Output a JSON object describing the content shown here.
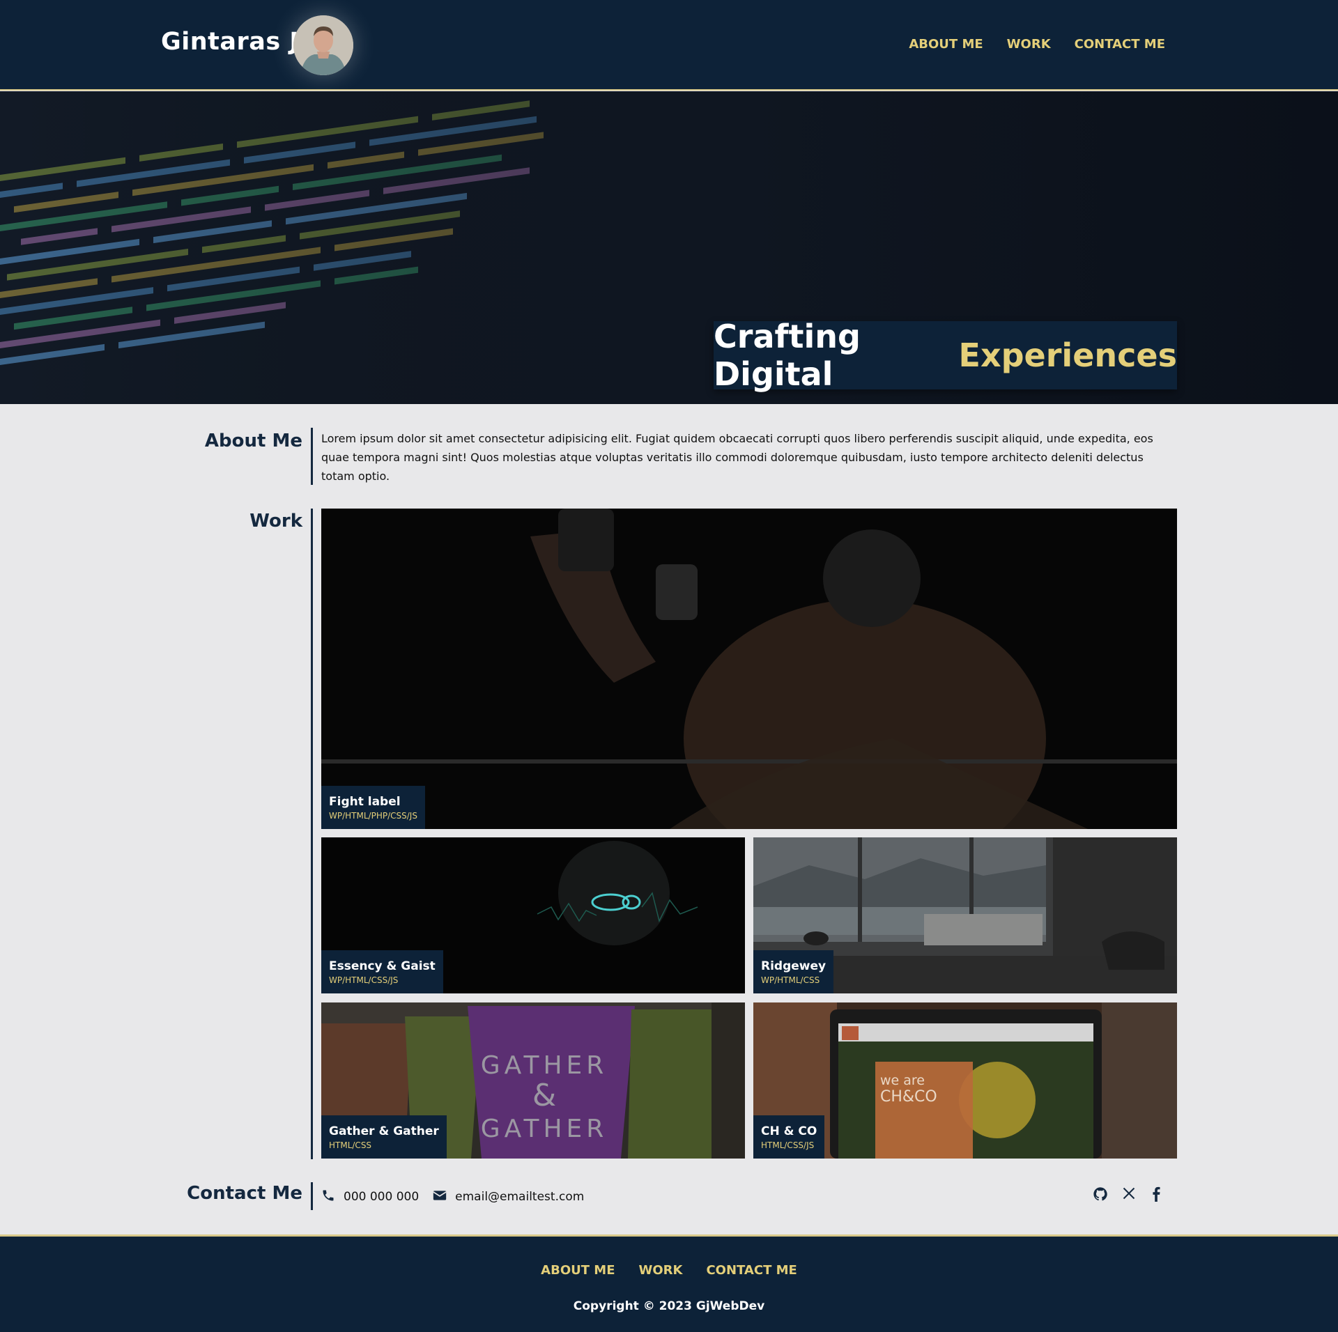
{
  "header": {
    "brand": "Gintaras J",
    "nav": [
      "ABOUT ME",
      "WORK",
      "CONTACT ME"
    ]
  },
  "hero": {
    "title_main": "Crafting Digital",
    "title_accent": "Experiences"
  },
  "about": {
    "title": "About Me",
    "text": "Lorem ipsum dolor sit amet consectetur adipisicing elit. Fugiat quidem obcaecati corrupti quos libero perferendis suscipit aliquid, unde expedita, eos quae tempora magni sint! Quos molestias atque voluptas veritatis illo commodi doloremque quibusdam, iusto tempore architecto deleniti delectus totam optio."
  },
  "work": {
    "title": "Work",
    "projects": [
      {
        "name": "Fight label",
        "tech": "WP/HTML/PHP/CSS/JS"
      },
      {
        "name": "Essency & Gaist",
        "tech": "WP/HTML/CSS/JS"
      },
      {
        "name": "Ridgewey",
        "tech": "WP/HTML/CSS"
      },
      {
        "name": "Gather & Gather",
        "tech": "HTML/CSS"
      },
      {
        "name": "CH & CO",
        "tech": "HTML/CSS/JS"
      }
    ],
    "artwork_text": {
      "gather": [
        "GATHER",
        "&",
        "GATHER"
      ],
      "chco": [
        "we are",
        "CH&CO"
      ]
    }
  },
  "contact": {
    "title": "Contact Me",
    "phone": "000 000 000",
    "email": "email@emailtest.com",
    "icons": [
      "phone-icon",
      "envelope-icon",
      "github-icon",
      "x-icon",
      "facebook-icon"
    ]
  },
  "footer": {
    "nav": [
      "ABOUT ME",
      "WORK",
      "CONTACT ME"
    ],
    "copyright": "Copyright © 2023 GjWebDev"
  },
  "colors": {
    "navy": "#0d2238",
    "gold": "#e4cf79",
    "background": "#e8e8ea"
  }
}
